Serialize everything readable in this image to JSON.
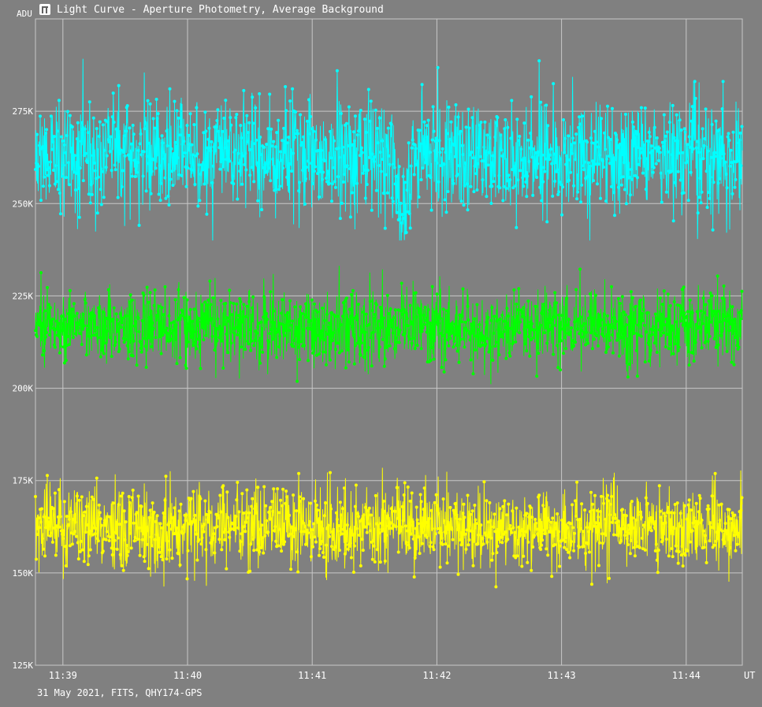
{
  "window": {
    "title": "Light Curve - Aperture Photometry, Average Background",
    "icon": "light-curve-app-icon"
  },
  "footer": {
    "info": "31 May 2021, FITS, QHY174-GPS"
  },
  "colors": {
    "background": "#808080",
    "grid": "#c8c8c8",
    "text": "#ffffff",
    "series_1": "#00ffff",
    "series_2": "#00ff00",
    "series_3": "#ffff00"
  },
  "chart_data": {
    "type": "line",
    "title": "Light Curve - Aperture Photometry, Average Background",
    "xlabel": "UT",
    "ylabel": "ADU",
    "x_ticks": [
      "11:39",
      "11:40",
      "11:41",
      "11:42",
      "11:43",
      "11:44"
    ],
    "x_tick_minutes": [
      39,
      40,
      41,
      42,
      43,
      44
    ],
    "xlim_minutes_after_11h": [
      38.78,
      44.45
    ],
    "y_ticks": [
      "125K",
      "150K",
      "175K",
      "200K",
      "225K",
      "250K",
      "275K"
    ],
    "y_tick_values": [
      125000,
      150000,
      175000,
      200000,
      225000,
      250000,
      275000
    ],
    "ylim": [
      125000,
      300000
    ],
    "grid": true,
    "markers": true,
    "series": [
      {
        "color": "#00ffff",
        "mean": 263000,
        "noise_sd": 7500,
        "range": [
          240000,
          294000
        ],
        "dip": {
          "center_minute": 41.72,
          "width_minutes": 0.05,
          "depth": 16000
        }
      },
      {
        "color": "#00ff00",
        "mean": 216500,
        "noise_sd": 5200,
        "range": [
          193000,
          240000
        ]
      },
      {
        "color": "#ffff00",
        "mean": 162500,
        "noise_sd": 5500,
        "range": [
          141000,
          185000
        ]
      }
    ],
    "points_per_series": 1800
  }
}
